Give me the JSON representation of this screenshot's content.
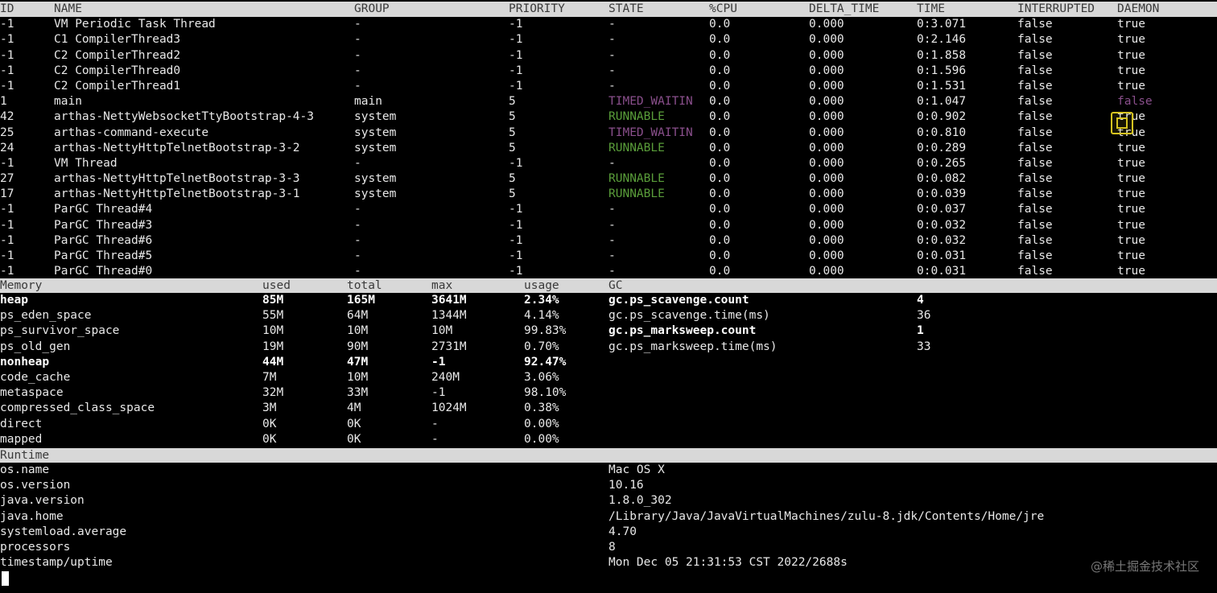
{
  "threads": {
    "headers": [
      "ID",
      "NAME",
      "GROUP",
      "PRIORITY",
      "STATE",
      "%CPU",
      "DELTA_TIME",
      "TIME",
      "INTERRUPTED",
      "DAEMON"
    ],
    "rows": [
      {
        "id": "-1",
        "name": "VM Periodic Task Thread",
        "group": "-",
        "priority": "-1",
        "state": "-",
        "cpu": "0.0",
        "delta": "0.000",
        "time": "0:3.071",
        "interrupted": "false",
        "daemon": "true"
      },
      {
        "id": "-1",
        "name": "C1 CompilerThread3",
        "group": "-",
        "priority": "-1",
        "state": "-",
        "cpu": "0.0",
        "delta": "0.000",
        "time": "0:2.146",
        "interrupted": "false",
        "daemon": "true"
      },
      {
        "id": "-1",
        "name": "C2 CompilerThread2",
        "group": "-",
        "priority": "-1",
        "state": "-",
        "cpu": "0.0",
        "delta": "0.000",
        "time": "0:1.858",
        "interrupted": "false",
        "daemon": "true"
      },
      {
        "id": "-1",
        "name": "C2 CompilerThread0",
        "group": "-",
        "priority": "-1",
        "state": "-",
        "cpu": "0.0",
        "delta": "0.000",
        "time": "0:1.596",
        "interrupted": "false",
        "daemon": "true"
      },
      {
        "id": "-1",
        "name": "C2 CompilerThread1",
        "group": "-",
        "priority": "-1",
        "state": "-",
        "cpu": "0.0",
        "delta": "0.000",
        "time": "0:1.531",
        "interrupted": "false",
        "daemon": "true"
      },
      {
        "id": "1",
        "name": "main",
        "group": "main",
        "priority": "5",
        "state": "TIMED_WAITIN",
        "cpu": "0.0",
        "delta": "0.000",
        "time": "0:1.047",
        "interrupted": "false",
        "daemon": "false"
      },
      {
        "id": "42",
        "name": "arthas-NettyWebsocketTtyBootstrap-4-3",
        "group": "system",
        "priority": "5",
        "state": "RUNNABLE",
        "cpu": "0.0",
        "delta": "0.000",
        "time": "0:0.902",
        "interrupted": "false",
        "daemon": "true"
      },
      {
        "id": "25",
        "name": "arthas-command-execute",
        "group": "system",
        "priority": "5",
        "state": "TIMED_WAITIN",
        "cpu": "0.0",
        "delta": "0.000",
        "time": "0:0.810",
        "interrupted": "false",
        "daemon": "true"
      },
      {
        "id": "24",
        "name": "arthas-NettyHttpTelnetBootstrap-3-2",
        "group": "system",
        "priority": "5",
        "state": "RUNNABLE",
        "cpu": "0.0",
        "delta": "0.000",
        "time": "0:0.289",
        "interrupted": "false",
        "daemon": "true"
      },
      {
        "id": "-1",
        "name": "VM Thread",
        "group": "-",
        "priority": "-1",
        "state": "-",
        "cpu": "0.0",
        "delta": "0.000",
        "time": "0:0.265",
        "interrupted": "false",
        "daemon": "true"
      },
      {
        "id": "27",
        "name": "arthas-NettyHttpTelnetBootstrap-3-3",
        "group": "system",
        "priority": "5",
        "state": "RUNNABLE",
        "cpu": "0.0",
        "delta": "0.000",
        "time": "0:0.082",
        "interrupted": "false",
        "daemon": "true"
      },
      {
        "id": "17",
        "name": "arthas-NettyHttpTelnetBootstrap-3-1",
        "group": "system",
        "priority": "5",
        "state": "RUNNABLE",
        "cpu": "0.0",
        "delta": "0.000",
        "time": "0:0.039",
        "interrupted": "false",
        "daemon": "true"
      },
      {
        "id": "-1",
        "name": "ParGC Thread#4",
        "group": "-",
        "priority": "-1",
        "state": "-",
        "cpu": "0.0",
        "delta": "0.000",
        "time": "0:0.037",
        "interrupted": "false",
        "daemon": "true"
      },
      {
        "id": "-1",
        "name": "ParGC Thread#3",
        "group": "-",
        "priority": "-1",
        "state": "-",
        "cpu": "0.0",
        "delta": "0.000",
        "time": "0:0.032",
        "interrupted": "false",
        "daemon": "true"
      },
      {
        "id": "-1",
        "name": "ParGC Thread#6",
        "group": "-",
        "priority": "-1",
        "state": "-",
        "cpu": "0.0",
        "delta": "0.000",
        "time": "0:0.032",
        "interrupted": "false",
        "daemon": "true"
      },
      {
        "id": "-1",
        "name": "ParGC Thread#5",
        "group": "-",
        "priority": "-1",
        "state": "-",
        "cpu": "0.0",
        "delta": "0.000",
        "time": "0:0.031",
        "interrupted": "false",
        "daemon": "true"
      },
      {
        "id": "-1",
        "name": "ParGC Thread#0",
        "group": "-",
        "priority": "-1",
        "state": "-",
        "cpu": "0.0",
        "delta": "0.000",
        "time": "0:0.031",
        "interrupted": "false",
        "daemon": "true"
      }
    ]
  },
  "memory": {
    "headers": [
      "Memory",
      "used",
      "total",
      "max",
      "usage",
      "GC"
    ],
    "rows": [
      {
        "name": "heap",
        "used": "85M",
        "total": "165M",
        "max": "3641M",
        "usage": "2.34%",
        "bold": true,
        "gc_name": "gc.ps_scavenge.count",
        "gc_value": "4",
        "gc_bold": true
      },
      {
        "name": "ps_eden_space",
        "used": "55M",
        "total": "64M",
        "max": "1344M",
        "usage": "4.14%",
        "bold": false,
        "gc_name": "gc.ps_scavenge.time(ms)",
        "gc_value": "36",
        "gc_bold": false
      },
      {
        "name": "ps_survivor_space",
        "used": "10M",
        "total": "10M",
        "max": "10M",
        "usage": "99.83%",
        "bold": false,
        "gc_name": "gc.ps_marksweep.count",
        "gc_value": "1",
        "gc_bold": true
      },
      {
        "name": "ps_old_gen",
        "used": "19M",
        "total": "90M",
        "max": "2731M",
        "usage": "0.70%",
        "bold": false,
        "gc_name": "gc.ps_marksweep.time(ms)",
        "gc_value": "33",
        "gc_bold": false
      },
      {
        "name": "nonheap",
        "used": "44M",
        "total": "47M",
        "max": "-1",
        "usage": "92.47%",
        "bold": true,
        "gc_name": "",
        "gc_value": "",
        "gc_bold": false
      },
      {
        "name": "code_cache",
        "used": "7M",
        "total": "10M",
        "max": "240M",
        "usage": "3.06%",
        "bold": false,
        "gc_name": "",
        "gc_value": "",
        "gc_bold": false
      },
      {
        "name": "metaspace",
        "used": "32M",
        "total": "33M",
        "max": "-1",
        "usage": "98.10%",
        "bold": false,
        "gc_name": "",
        "gc_value": "",
        "gc_bold": false
      },
      {
        "name": "compressed_class_space",
        "used": "3M",
        "total": "4M",
        "max": "1024M",
        "usage": "0.38%",
        "bold": false,
        "gc_name": "",
        "gc_value": "",
        "gc_bold": false
      },
      {
        "name": "direct",
        "used": "0K",
        "total": "0K",
        "max": "-",
        "usage": "0.00%",
        "bold": false,
        "gc_name": "",
        "gc_value": "",
        "gc_bold": false
      },
      {
        "name": "mapped",
        "used": "0K",
        "total": "0K",
        "max": "-",
        "usage": "0.00%",
        "bold": false,
        "gc_name": "",
        "gc_value": "",
        "gc_bold": false
      }
    ]
  },
  "runtime": {
    "header": "Runtime",
    "rows": [
      {
        "key": "os.name",
        "value": "Mac OS X"
      },
      {
        "key": "os.version",
        "value": "10.16"
      },
      {
        "key": "java.version",
        "value": "1.8.0_302"
      },
      {
        "key": "java.home",
        "value": "/Library/Java/JavaVirtualMachines/zulu-8.jdk/Contents/Home/jre"
      },
      {
        "key": "systemload.average",
        "value": "4.70"
      },
      {
        "key": "processors",
        "value": "8"
      },
      {
        "key": "timestamp/uptime",
        "value": "Mon Dec 05 21:31:53 CST 2022/2688s"
      }
    ]
  },
  "watermark": "@稀土掘金技术社区",
  "colors": {
    "runnable": "#5a9e3a",
    "timed_waiting": "#8a4f8c",
    "header_bg": "#d8d8d8",
    "focus": "#d6c320"
  }
}
